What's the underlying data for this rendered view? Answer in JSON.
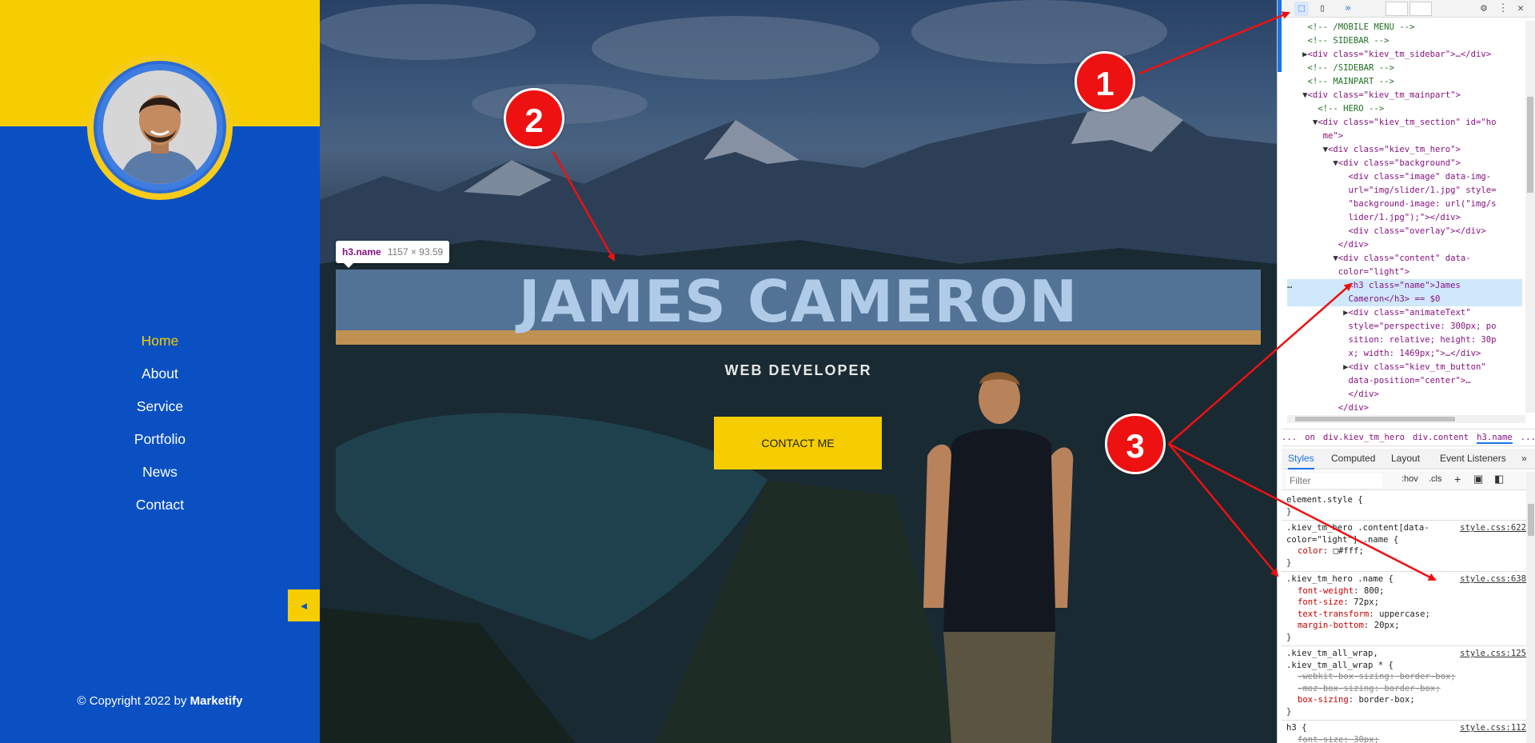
{
  "sidebar": {
    "nav": [
      {
        "label": "Home",
        "active": true
      },
      {
        "label": "About"
      },
      {
        "label": "Service"
      },
      {
        "label": "Portfolio"
      },
      {
        "label": "News"
      },
      {
        "label": "Contact"
      }
    ],
    "collapse_icon": "◄",
    "copyright_prefix": "© Copyright 2022 by ",
    "copyright_brand": "Marketify",
    "colors": {
      "primary": "#0a50c2",
      "accent": "#f5cd00"
    }
  },
  "hero": {
    "name": "JAMES CAMERON",
    "role": "WEB DEVELOPER",
    "contact_button": "CONTACT ME",
    "inspect_tooltip": {
      "tag": "h3.name",
      "dimensions": "1157 × 93.59"
    }
  },
  "devtools": {
    "toolbar": {
      "inspect_icon": "inspect-element-icon",
      "device_icon": "device-toolbar-icon",
      "more": "»",
      "settings": "⚙",
      "menu": "⋮",
      "close": "✕"
    },
    "dom_lines": [
      {
        "indent": "    ",
        "text": "<!-- /MOBILE MENU -->",
        "kind": "comment"
      },
      {
        "indent": "    ",
        "text": "<!-- SIDEBAR -->",
        "kind": "comment"
      },
      {
        "indent": "   ▶",
        "text": "<div class=\"kiev_tm_sidebar\">…</div>",
        "kind": "tag"
      },
      {
        "indent": "    ",
        "text": "<!-- /SIDEBAR -->",
        "kind": "comment"
      },
      {
        "indent": "    ",
        "text": "<!-- MAINPART -->",
        "kind": "comment"
      },
      {
        "indent": "   ▼",
        "text": "<div class=\"kiev_tm_mainpart\">",
        "kind": "tag"
      },
      {
        "indent": "      ",
        "text": "<!-- HERO -->",
        "kind": "comment"
      },
      {
        "indent": "     ▼",
        "text": "<div class=\"kiev_tm_section\" id=\"ho",
        "kind": "tag"
      },
      {
        "indent": "       ",
        "text": "me\">",
        "kind": "tag"
      },
      {
        "indent": "       ▼",
        "text": "<div class=\"kiev_tm_hero\">",
        "kind": "tag"
      },
      {
        "indent": "         ▼",
        "text": "<div class=\"background\">",
        "kind": "tag"
      },
      {
        "indent": "            ",
        "text": "<div class=\"image\" data-img-",
        "kind": "tag"
      },
      {
        "indent": "            ",
        "text": "url=\"img/slider/1.jpg\" style=",
        "kind": "tag"
      },
      {
        "indent": "            ",
        "text": "\"background-image: url(\"img/s",
        "kind": "tag"
      },
      {
        "indent": "            ",
        "text": "lider/1.jpg\");\"></div>",
        "kind": "tag"
      },
      {
        "indent": "            ",
        "text": "<div class=\"overlay\"></div>",
        "kind": "tag"
      },
      {
        "indent": "          ",
        "text": "</div>",
        "kind": "tag"
      },
      {
        "indent": "         ▼",
        "text": "<div class=\"content\" data-",
        "kind": "tag"
      },
      {
        "indent": "          ",
        "text": "color=\"light\">",
        "kind": "tag"
      },
      {
        "indent": "…           ",
        "text": "<h3 class=\"name\">James",
        "kind": "tag",
        "selected": true
      },
      {
        "indent": "            ",
        "text": "Cameron</h3> == $0",
        "kind": "tag",
        "selected": true
      },
      {
        "indent": "           ▶",
        "text": "<div class=\"animateText\"",
        "kind": "tag"
      },
      {
        "indent": "            ",
        "text": "style=\"perspective: 300px; po",
        "kind": "tag"
      },
      {
        "indent": "            ",
        "text": "sition: relative; height: 30p",
        "kind": "tag"
      },
      {
        "indent": "            ",
        "text": "x; width: 1469px;\">…</div>",
        "kind": "tag"
      },
      {
        "indent": "           ▶",
        "text": "<div class=\"kiev_tm_button\"",
        "kind": "tag"
      },
      {
        "indent": "            ",
        "text": "data-position=\"center\">…",
        "kind": "tag"
      },
      {
        "indent": "            ",
        "text": "</div>",
        "kind": "tag"
      },
      {
        "indent": "          ",
        "text": "</div>",
        "kind": "tag"
      }
    ],
    "breadcrumb": [
      "...",
      "on",
      "div.kiev_tm_hero",
      "div.content",
      "h3.name",
      "..."
    ],
    "tabs": [
      "Styles",
      "Computed",
      "Layout",
      "Event Listeners",
      "»"
    ],
    "filter_placeholder": "Filter",
    "filter_buttons": [
      ":hov",
      ".cls",
      "+"
    ],
    "rules": [
      {
        "selector": "element.style {",
        "source": "",
        "props": []
      },
      {
        "selector": ".kiev_tm_hero .content[data-\ncolor=\"light\"] .name {",
        "source": "style.css:622",
        "props": [
          {
            "name": "color",
            "value": "□#fff;"
          }
        ]
      },
      {
        "selector": ".kiev_tm_hero .name {",
        "source": "style.css:638",
        "props": [
          {
            "name": "font-weight",
            "value": "800;"
          },
          {
            "name": "font-size",
            "value": "72px;"
          },
          {
            "name": "text-transform",
            "value": "uppercase;"
          },
          {
            "name": "margin-bottom",
            "value": "20px;"
          }
        ]
      },
      {
        "selector": ".kiev_tm_all_wrap,\n.kiev_tm_all_wrap * {",
        "source": "style.css:125",
        "props": [
          {
            "name": "-webkit-box-sizing",
            "value": "border-box;",
            "struck": true
          },
          {
            "name": "-moz-box-sizing",
            "value": "border-box;",
            "struck": true
          },
          {
            "name": "box-sizing",
            "value": "border-box;"
          }
        ]
      },
      {
        "selector": "h3 {",
        "source": "style.css:112",
        "props": [
          {
            "name": "font-size",
            "value": "30px;",
            "struck": true
          }
        ]
      }
    ]
  },
  "annotations": [
    {
      "label": "1"
    },
    {
      "label": "2"
    },
    {
      "label": "3"
    }
  ],
  "colors": {
    "annotation_red": "#ee1111",
    "devtools_selection": "#cfe8fc"
  }
}
